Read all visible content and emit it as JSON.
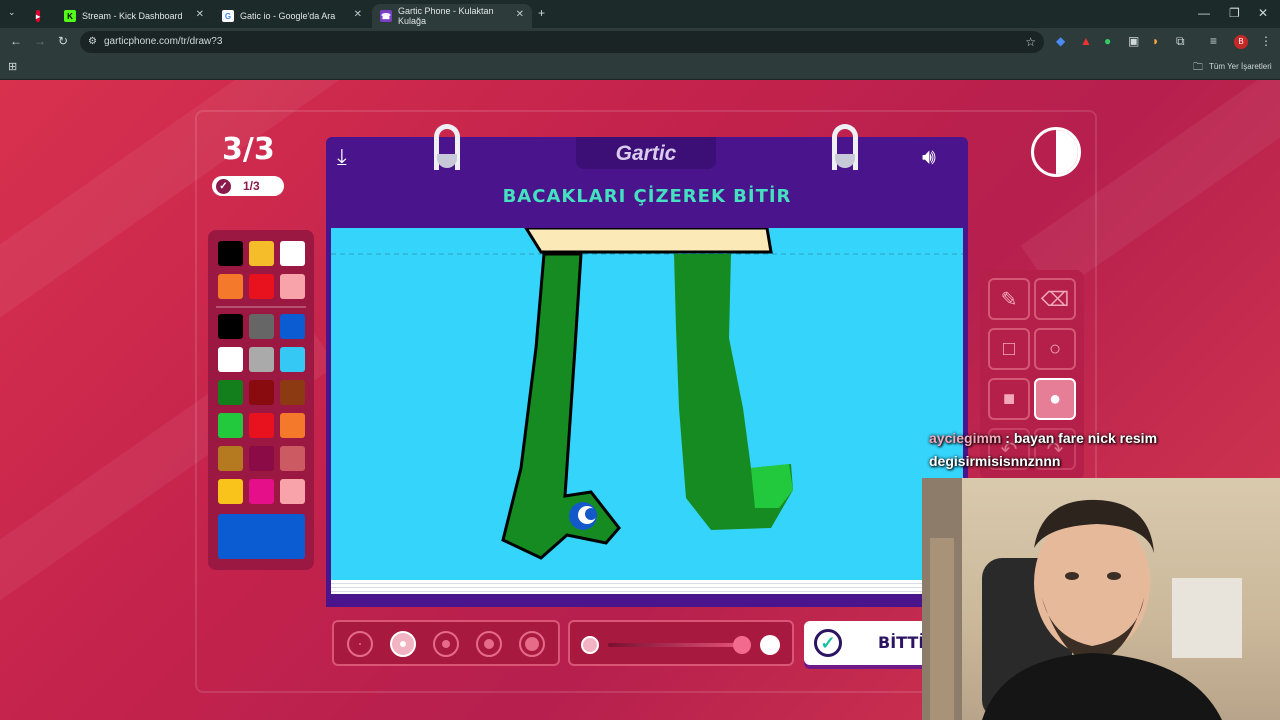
{
  "browser": {
    "tabs": [
      {
        "label": "",
        "active": false
      },
      {
        "label": "Stream - Kick Dashboard",
        "active": false
      },
      {
        "label": "Gatic io - Google'da Ara",
        "active": false
      },
      {
        "label": "Gartic Phone - Kulaktan Kulağa",
        "active": true
      }
    ],
    "url": "garticphone.com/tr/draw?3",
    "bookmarks_label": "Tüm Yer İşaretleri"
  },
  "game": {
    "round": "3/3",
    "done_count": "1/3",
    "logo": "Gartic",
    "task": "BACAKLARI ÇİZEREK BİTİR",
    "palette": [
      "#000000",
      "#f6bd2b",
      "#ffffff",
      "#f5792a",
      "#e8121f",
      "#f8a3aa",
      "#000000",
      "#666666",
      "#0b5bd3",
      "#ffffff",
      "#aaaaaa",
      "#36c8f5",
      "#137f1c",
      "#8a0b0f",
      "#8c3a12",
      "#22c93c",
      "#e8121f",
      "#f5792a",
      "#b57a1f",
      "#8a0b46",
      "#cc5a62",
      "#f9c31b",
      "#e60f8a",
      "#f8a3aa"
    ],
    "selected_color": "#0b5bd3",
    "tools": [
      "pencil-icon",
      "eraser-icon",
      "square-outline-icon",
      "circle-outline-icon",
      "square-filled-icon",
      "circle-filled-icon"
    ],
    "selected_tool": "circle-filled-icon",
    "brush_sizes": 5,
    "selected_brush_size": 2,
    "done_button_label": "BİTTİ!"
  },
  "chat": {
    "user": "ayciegimm",
    "sep": " : ",
    "message": "bayan fare nick resim degisirmisisnnznnn"
  }
}
